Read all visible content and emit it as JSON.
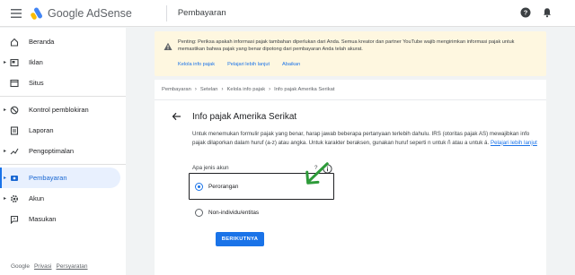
{
  "app": {
    "logo_text": "Google AdSense",
    "page_title": "Pembayaran"
  },
  "sidebar": {
    "items": [
      {
        "label": "Beranda",
        "icon": "home-icon",
        "caret": false,
        "active": false
      },
      {
        "label": "Iklan",
        "icon": "ads-icon",
        "caret": true,
        "active": false
      },
      {
        "label": "Situs",
        "icon": "sites-icon",
        "caret": false,
        "active": false
      },
      {
        "label": "Kontrol pemblokiran",
        "icon": "block-icon",
        "caret": true,
        "active": false
      },
      {
        "label": "Laporan",
        "icon": "report-icon",
        "caret": false,
        "active": false
      },
      {
        "label": "Pengoptimalan",
        "icon": "optimize-icon",
        "caret": true,
        "active": false
      },
      {
        "label": "Pembayaran",
        "icon": "payments-icon",
        "caret": true,
        "active": true
      },
      {
        "label": "Akun",
        "icon": "account-gear-icon",
        "caret": true,
        "active": false
      },
      {
        "label": "Masukan",
        "icon": "feedback-icon",
        "caret": false,
        "active": false
      }
    ],
    "footer": {
      "brand": "Google",
      "privacy": "Privasi",
      "terms": "Persyaratan"
    }
  },
  "banner": {
    "text": "Penting: Periksa apakah informasi pajak tambahan diperlukan dari Anda. Semua kreator dan partner YouTube wajib mengirimkan informasi pajak untuk memastikan bahwa pajak yang benar dipotong dari pembayaran Anda telah akurat.",
    "links": [
      "Kelola info pajak",
      "Pelajari lebih lanjut",
      "Abaikan"
    ]
  },
  "breadcrumb": [
    "Pembayaran",
    "Setelan",
    "Kelola info pajak",
    "Info pajak Amerika Serikat"
  ],
  "form": {
    "title": "Info pajak Amerika Serikat",
    "description": "Untuk menemukan formulir pajak yang benar, harap jawab beberapa pertanyaan terlebih dahulu. IRS (otoritas pajak AS) mewajibkan info pajak dilaporkan dalam huruf (a-z) atau angka. Untuk karakter beraksen, gunakan huruf seperti n untuk ñ atau a untuk á.",
    "learn_more": "Pelajari lebih lanjut",
    "question": "Apa jenis akun",
    "question_mark": "?",
    "options": [
      {
        "label": "Perorangan",
        "checked": true
      },
      {
        "label": "Non-individu/entitas",
        "checked": false
      }
    ],
    "next_button": "BERIKUTNYA"
  },
  "colors": {
    "accent": "#1a73e8",
    "banner_bg": "#fef7e0",
    "arrow": "#2e9b3a"
  }
}
